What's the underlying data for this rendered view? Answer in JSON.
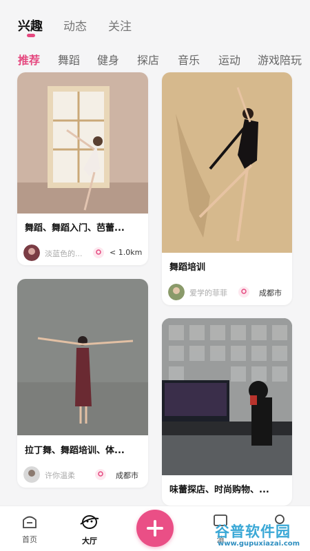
{
  "top_tabs": [
    "兴趣",
    "动态",
    "关注"
  ],
  "categories": [
    "推荐",
    "舞蹈",
    "健身",
    "探店",
    "音乐",
    "运动",
    "游戏陪玩"
  ],
  "cards": [
    {
      "title": "舞蹈、舞蹈入门、芭蕾...",
      "user": "淡蓝色的...",
      "distance": "< 1.0km"
    },
    {
      "title": "舞蹈培训",
      "user": "爱学的菲菲",
      "distance": "成都市"
    },
    {
      "title": "拉丁舞、舞蹈培训、体...",
      "user": "许你温柔",
      "distance": "成都市"
    },
    {
      "title": "味蕾探店、时尚购物、...",
      "user": "",
      "distance": ""
    }
  ],
  "bottom_nav": {
    "home": "首页",
    "hall": "大厅",
    "messages": "消",
    "me": ""
  },
  "watermark": {
    "main": "谷普软件园",
    "url": "www.gupuxiazai.com"
  },
  "colors": {
    "accent": "#e5487f",
    "add_button": "#ea4f86",
    "watermark": "#3aa8d6"
  }
}
